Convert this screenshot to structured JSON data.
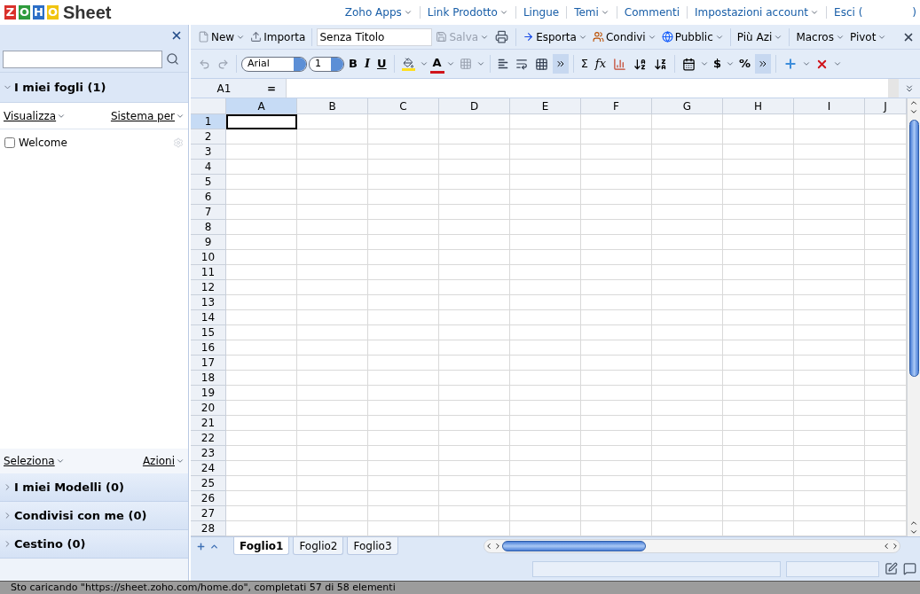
{
  "header": {
    "logo": {
      "letters": [
        "Z",
        "O",
        "H",
        "O"
      ],
      "product": "Sheet"
    },
    "nav": [
      {
        "label": "Zoho Apps",
        "dropdown": true
      },
      {
        "label": "Link Prodotto",
        "dropdown": true
      },
      {
        "label": "Lingue",
        "dropdown": false
      },
      {
        "label": "Temi",
        "dropdown": true
      },
      {
        "label": "Commenti",
        "dropdown": false
      },
      {
        "label": "Impostazioni account",
        "dropdown": true
      },
      {
        "label": "Esci (",
        "dropdown": false
      }
    ],
    "nav_end": ")"
  },
  "sidebar": {
    "main_section": {
      "title": "I miei fogli (1)",
      "expanded": true
    },
    "view_links": [
      {
        "label": "Visualizza"
      },
      {
        "label": "Sistema per"
      }
    ],
    "files": [
      {
        "name": "Welcome",
        "checked": false
      }
    ],
    "footer_links": [
      {
        "label": "Seleziona"
      },
      {
        "label": "Azioni"
      }
    ],
    "sections": [
      {
        "title": "I miei Modelli (0)",
        "expanded": false
      },
      {
        "title": "Condivisi con me (0)",
        "expanded": false
      },
      {
        "title": "Cestino (0)",
        "expanded": false
      }
    ]
  },
  "toolbar": {
    "file_actions": [
      {
        "label": "New",
        "dropdown": true
      },
      {
        "label": "Importa",
        "dropdown": false
      }
    ],
    "title_field": {
      "value": "Senza Titolo"
    },
    "save": {
      "label": "Salva",
      "disabled": true
    },
    "share_actions": [
      {
        "label": "Esporta",
        "dropdown": true
      },
      {
        "label": "Condivi",
        "dropdown": true
      },
      {
        "label": "Pubblic",
        "dropdown": true
      }
    ],
    "more_actions": [
      {
        "label": "Più Azi",
        "dropdown": true
      },
      {
        "label": "Macros",
        "dropdown": true
      },
      {
        "label": "Pivot",
        "dropdown": true
      }
    ]
  },
  "format_bar": {
    "font_name": "Arial",
    "font_size": "1",
    "styles": [
      "B",
      "I",
      "U"
    ],
    "font_color_letter": "A",
    "sum": "Σ",
    "function": "fx",
    "currency": "$",
    "percent": "%"
  },
  "formula_bar": {
    "cell_ref": "A1",
    "equals": "="
  },
  "columns": [
    {
      "label": "A",
      "selected": true
    },
    {
      "label": "B",
      "selected": false
    },
    {
      "label": "C",
      "selected": false
    },
    {
      "label": "D",
      "selected": false
    },
    {
      "label": "E",
      "selected": false
    },
    {
      "label": "F",
      "selected": false
    },
    {
      "label": "G",
      "selected": false
    },
    {
      "label": "H",
      "selected": false
    },
    {
      "label": "I",
      "selected": false
    },
    {
      "label": "J",
      "selected": false
    }
  ],
  "rows": [
    {
      "label": "1",
      "selected": true
    },
    {
      "label": "2",
      "selected": false
    },
    {
      "label": "3",
      "selected": false
    },
    {
      "label": "4",
      "selected": false
    },
    {
      "label": "5",
      "selected": false
    },
    {
      "label": "6",
      "selected": false
    },
    {
      "label": "7",
      "selected": false
    },
    {
      "label": "8",
      "selected": false
    },
    {
      "label": "9",
      "selected": false
    },
    {
      "label": "10",
      "selected": false
    },
    {
      "label": "11",
      "selected": false
    },
    {
      "label": "12",
      "selected": false
    },
    {
      "label": "13",
      "selected": false
    },
    {
      "label": "14",
      "selected": false
    },
    {
      "label": "15",
      "selected": false
    },
    {
      "label": "16",
      "selected": false
    },
    {
      "label": "17",
      "selected": false
    },
    {
      "label": "18",
      "selected": false
    },
    {
      "label": "19",
      "selected": false
    },
    {
      "label": "20",
      "selected": false
    },
    {
      "label": "21",
      "selected": false
    },
    {
      "label": "22",
      "selected": false
    },
    {
      "label": "23",
      "selected": false
    },
    {
      "label": "24",
      "selected": false
    },
    {
      "label": "25",
      "selected": false
    },
    {
      "label": "26",
      "selected": false
    },
    {
      "label": "27",
      "selected": false
    },
    {
      "label": "28",
      "selected": false
    }
  ],
  "sheet_tabs": [
    {
      "label": "Foglio1",
      "selected": true
    },
    {
      "label": "Foglio2",
      "selected": false
    },
    {
      "label": "Foglio3",
      "selected": false
    }
  ],
  "browser_status": "Sto caricando \"https://sheet.zoho.com/home.do\", completati 57 di 58 elementi"
}
